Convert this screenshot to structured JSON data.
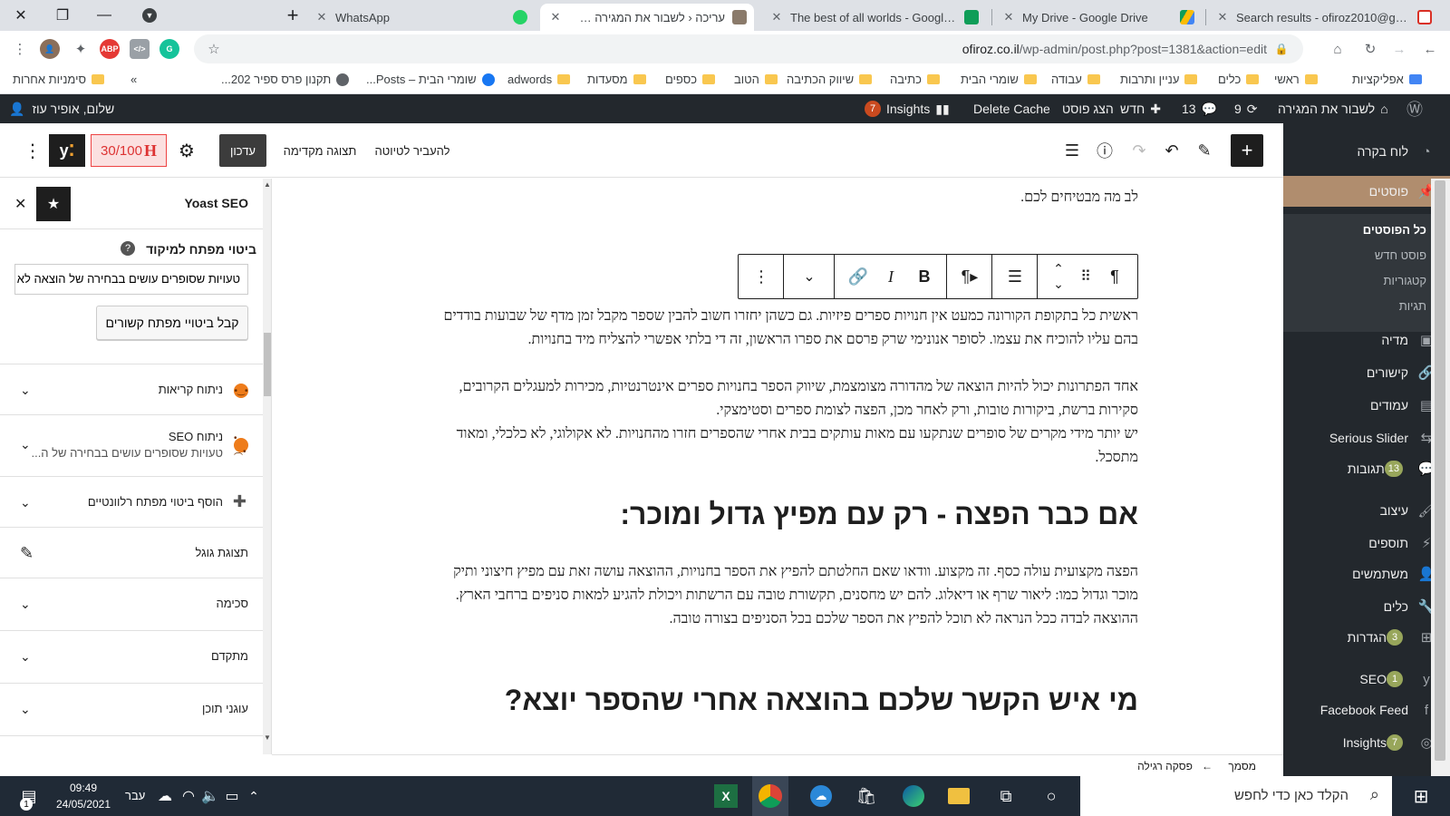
{
  "tabs": [
    {
      "title": "WhatsApp",
      "color": "#25d366"
    },
    {
      "title": "עריכה ‹ לשבור את המגירה — ווו",
      "color": "#8a7a6a",
      "active": true
    },
    {
      "title": "The best of all worlds - Google Sh",
      "color": "#0f9d58"
    },
    {
      "title": "My Drive - Google Drive",
      "color": "#fbbc04"
    },
    {
      "title": "Search results - ofiroz2010@gma",
      "color": "#d93025"
    }
  ],
  "new_tab_label": "+",
  "url": {
    "host": "ofiroz.co.il",
    "path": "/wp-admin/post.php?post=1381&action=edit"
  },
  "bookmarks": [
    "אפליקציות",
    "ראשי",
    "כלים",
    "עניין ותרבות",
    "עבודה",
    "שומרי הבית",
    "כתיבה",
    "שיווק הכתיבה",
    "הטוב",
    "כספים",
    "מסעדות",
    "adwords",
    "שומרי הבית – Posts...",
    "תקנון פרס ספיר 202...",
    "»",
    "סימניות אחרות"
  ],
  "wpbar": {
    "site": "לשבור את המגירה",
    "updates": "9",
    "comments": "13",
    "new": "חדש",
    "view_post": "הצג פוסט",
    "delete_cache": "Delete Cache",
    "insights": "Insights",
    "insights_badge": "7",
    "greeting": "שלום, אופיר עוז"
  },
  "adminmenu": [
    {
      "label": "לוח בקרה",
      "icon": "dashboard-icon"
    },
    {
      "label": "פוסטים",
      "icon": "pin-icon",
      "current": true
    },
    {
      "label": "מדיה",
      "icon": "media-icon"
    },
    {
      "label": "קישורים",
      "icon": "link-icon"
    },
    {
      "label": "עמודים",
      "icon": "page-icon"
    },
    {
      "label": "Serious Slider",
      "icon": "slider-icon"
    },
    {
      "label": "תגובות",
      "icon": "comment-icon",
      "badge": "13"
    },
    {
      "label": "עיצוב",
      "icon": "brush-icon"
    },
    {
      "label": "תוספים",
      "icon": "plugin-icon"
    },
    {
      "label": "משתמשים",
      "icon": "user-icon"
    },
    {
      "label": "כלים",
      "icon": "wrench-icon"
    },
    {
      "label": "הגדרות",
      "icon": "settings-icon",
      "badge": "3"
    },
    {
      "label": "SEO",
      "icon": "yoast-icon",
      "badge": "1"
    },
    {
      "label": "Facebook Feed",
      "icon": "facebook-icon"
    },
    {
      "label": "Insights",
      "icon": "insights-icon",
      "badge": "7"
    }
  ],
  "submenu": [
    "כל הפוסטים",
    "פוסט חדש",
    "קטגוריות",
    "תגיות"
  ],
  "toolbar": {
    "switch_draft": "להעביר לטיוטה",
    "preview": "תצוגה מקדימה",
    "update": "עדכון",
    "score": "30/100"
  },
  "yoast": {
    "title": "Yoast SEO",
    "focus_label": "ביטוי מפתח למיקוד",
    "focus_value": "טעויות שסופרים עושים בבחירה של הוצאה לא",
    "related_btn": "קבל ביטויי מפתח קשורים",
    "readability": "ניתוח קריאות",
    "seo_analysis": "ניתוח SEO",
    "seo_sub": "טעויות שסופרים עושים בבחירה של ה...",
    "add_keyphrase": "הוסף ביטוי מפתח רלוונטיים",
    "google_preview": "תצוגת גוגל",
    "schema": "סכימה",
    "advanced": "מתקדם",
    "cornerstone": "עוגני תוכן"
  },
  "content": {
    "top_line": "לב מה מבטיחים לכם.",
    "p1": "ראשית כל בתקופת הקורונה כמעט אין חנויות ספרים פיזיות. גם כשהן יחזרו חשוב להבין שספר מקבל זמן מדף של שבועות בודדים בהם עליו להוכיח את עצמו. לסופר אנונימי שרק פרסם את ספרו הראשון, זה די בלתי אפשרי להצליח מיד בחנויות.",
    "p2": "אחד הפתרונות יכול להיות הוצאה של מהדורה מצומצמת, שיווק הספר בחנויות ספרים אינטרנטיות, מכירות למעגלים הקרובים, סקירות ברשת, ביקורות טובות, ורק לאחר מכן, הפצה לצומת ספרים וסטימצקי.",
    "p3": "יש יותר מידי מקרים של סופרים שנתקעו עם מאות עותקים בבית אחרי שהספרים חזרו מהחנויות. לא אקולוגי, לא כלכלי, ומאוד מתסכל.",
    "h1": "אם כבר הפצה - רק עם מפיץ גדול ומוכר:",
    "p4": "הפצה מקצועית עולה כסף. זה מקצוע. וודאו שאם החלטתם להפיץ את הספר בחנויות, ההוצאה עושה זאת עם מפיץ חיצוני ותיק מוכר וגדול כמו: ליאור שרף או דיאלוג. להם יש מחסנים, תקשורת טובה עם הרשתות ויכולת להגיע למאות סניפים ברחבי הארץ. ההוצאה לבדה ככל הנראה לא תוכל להפיץ את הספר שלכם בכל הסניפים בצורה טובה.",
    "h2": "מי איש הקשר שלכם בהוצאה אחרי שהספר יוצא?"
  },
  "footer": {
    "document": "מסמך",
    "arrow": "←",
    "block": "פסקה רגילה"
  },
  "taskbar": {
    "search_placeholder": "הקלד כאן כדי לחפש",
    "time": "09:49",
    "date": "24/05/2021",
    "lang": "עבר",
    "notif_count": "1"
  }
}
